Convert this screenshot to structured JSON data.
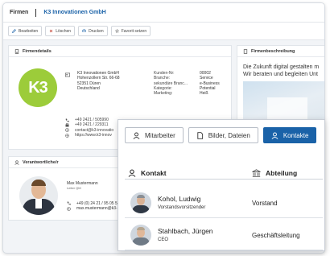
{
  "header": {
    "breadcrumb": "Firmen",
    "company": "K3 Innovationen GmbH"
  },
  "toolbar": [
    {
      "label": "Bearbeiten",
      "icon": "edit-icon"
    },
    {
      "label": "Löschen",
      "icon": "delete-icon"
    },
    {
      "label": "Drucken",
      "icon": "print-icon"
    },
    {
      "label": "Favorit setzen",
      "icon": "star-icon"
    }
  ],
  "firmendetails": {
    "title": "Firmendetails",
    "logo_text": "K3",
    "address": [
      "K3 Innovationen GmbH",
      "Hohenzollern Str. 66-68",
      "52351 Düren",
      "Deutschland"
    ],
    "fields": [
      {
        "label": "Kunden-Nr:",
        "value": "00002"
      },
      {
        "label": "Branche:",
        "value": "Service"
      },
      {
        "label": "sekundäre Branc...",
        "value": "e-Business"
      },
      {
        "label": "Kategorie:",
        "value": "Potential"
      },
      {
        "label": "Marketing:",
        "value": "Heiß"
      }
    ],
    "contacts": [
      "+49 2421 / 505990",
      "+49 2421 / 229311",
      "contact@k3-innovatio",
      "https://www.k3-innov"
    ]
  },
  "firmenbeschreibung": {
    "title": "Firmenbeschreibung",
    "text_line1": "Die Zukunft digital gestalten m",
    "text_line2": "Wir beraten und begleiten Unt"
  },
  "verantwortliche": {
    "title": "Verantwortliche/r",
    "name": "Max Mustermann",
    "role": "Leiter QM",
    "phone": "+49 (0) 24 21 / 95 05 5",
    "email": "max.mustermann@k3-"
  },
  "panel": {
    "tabs": [
      {
        "label": "Mitarbeiter",
        "active": false
      },
      {
        "label": "Bilder, Dateien",
        "active": false
      },
      {
        "label": "Kontakte",
        "active": true
      }
    ],
    "col_contact": "Kontakt",
    "col_department": "Abteilung",
    "rows": [
      {
        "name": "Kohol, Ludwig",
        "role": "Vorstandsvorsitzender",
        "department": "Vorstand"
      },
      {
        "name": "Stahlbach, Jürgen",
        "role": "CEO",
        "department": "Geschäftsleitung"
      }
    ]
  },
  "colors": {
    "accent": "#1a62a8",
    "logo_green": "#9ccc3a"
  }
}
